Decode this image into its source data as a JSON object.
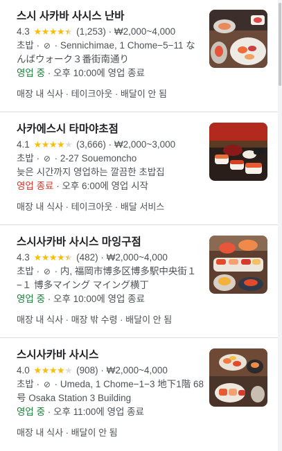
{
  "results": [
    {
      "name": "스시 사카바 사시스 난바",
      "rating": "4.3",
      "stars": 4.5,
      "reviews": "(1,253)",
      "price": "₩2,000~4,000",
      "category": "초밥",
      "no_delivery_icon": "no-delivery-icon",
      "address": "Sennichimae, 1 Chome−5−11 なんばウォーク３番街南通り",
      "status": "영업 중",
      "status_type": "open",
      "hours": "오후 10:00에 영업 종료",
      "services": "매장 내 식사 · 테이크아웃 · 배달이 안 됨"
    },
    {
      "name": "사카에스시 타마야초점",
      "rating": "4.1",
      "stars": 4,
      "reviews": "(3,666)",
      "price": "₩2,000~3,000",
      "category": "초밥",
      "no_delivery_icon": "no-delivery-icon",
      "address": "2-27 Souemoncho",
      "description": "늦은 시간까지 영업하는 깔끔한 초밥집",
      "status": "영업 종료",
      "status_type": "closed",
      "hours": "오후 6:00에 영업 시작",
      "services": "매장 내 식사 · 테이크아웃 · 배달 서비스"
    },
    {
      "name": "스시사카바 사시스 마잉구점",
      "rating": "4.3",
      "stars": 4.5,
      "reviews": "(482)",
      "price": "₩2,000~4,000",
      "category": "초밥",
      "no_delivery_icon": "no-delivery-icon",
      "address": "内, 福岡市博多区博多駅中央街１−１ 博多マイング マイング横丁",
      "status": "영업 중",
      "status_type": "open",
      "hours": "오후 10:00에 영업 종료",
      "services": "매장 내 식사 · 매장 밖 수령 · 배달이 안 됨"
    },
    {
      "name": "스시사카바 사시스",
      "rating": "4.0",
      "stars": 4,
      "reviews": "(908)",
      "price": "₩2,000~4,000",
      "category": "초밥",
      "no_delivery_icon": "no-delivery-icon",
      "address": "Umeda, 1 Chome−1−3 地下1階 68号 Osaka Station 3 Building",
      "status": "영업 중",
      "status_type": "open",
      "hours": "오후 11:00에 영업 종료",
      "services": "매장 내 식사 · 배달이 안 됨"
    }
  ],
  "colors": {
    "star": "#fbbc04",
    "open": "#188038",
    "closed": "#d93025",
    "secondary_text": "#4d5156",
    "divider": "#dadce0"
  }
}
